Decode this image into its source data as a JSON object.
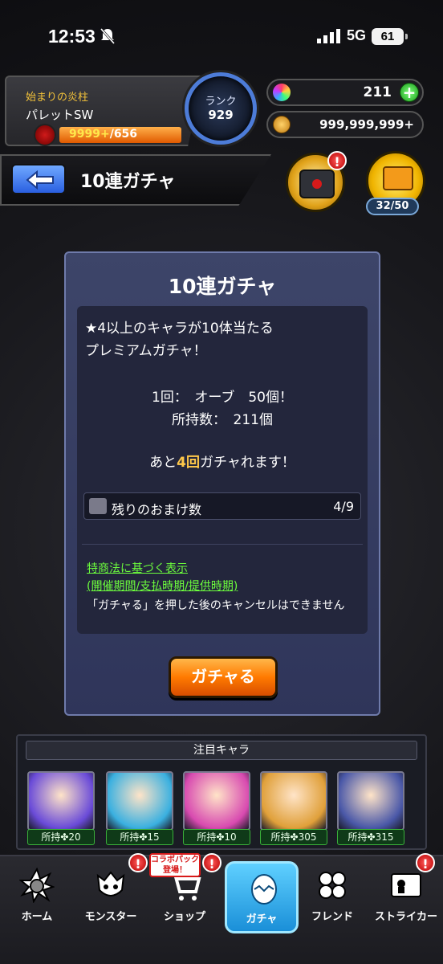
{
  "status_bar": {
    "time": "12:53",
    "network": "5G",
    "battery": "61"
  },
  "player": {
    "title": "始まりの炎柱",
    "name": "パレットSW",
    "stamina_current": "9999+",
    "stamina_max": "/656",
    "rank_label": "ランク",
    "rank": "929"
  },
  "resources": {
    "orbs": "211",
    "gold": "999,999,999+"
  },
  "page": {
    "title": "10連ガチャ",
    "reward_count": "32/50"
  },
  "dialog": {
    "title": "10連ガチャ",
    "desc_line1": "★4以上のキャラが10体当たる",
    "desc_line2": "プレミアムガチャ！",
    "cost_line": "1回：　オーブ　50個！",
    "owned_line": "所持数：　211個",
    "remain_prefix": "あと",
    "remain_count": "4回",
    "remain_suffix": "ガチャれます！",
    "bonus_label": "残りのおまけ数",
    "bonus_value": "4/9",
    "legal_link1": "特商法に基づく表示",
    "legal_link2": "(開催期間/支払時期/提供時期)",
    "legal_note": "「ガチャる」を押した後のキャンセルはできません",
    "gacha_button": "ガチャる"
  },
  "featured": {
    "title": "注目キャラ",
    "cards": [
      {
        "owned": "所持✤20",
        "color": "#6a4bd8"
      },
      {
        "owned": "所持✤15",
        "color": "#3ab0e0"
      },
      {
        "owned": "所持✤10",
        "color": "#d84ab0"
      },
      {
        "owned": "所持✤305",
        "color": "#e0a03a"
      },
      {
        "owned": "所持✤315",
        "color": "#4a58a8"
      }
    ]
  },
  "nav": {
    "items": [
      {
        "label": "ホーム"
      },
      {
        "label": "モンスター"
      },
      {
        "label": "ショップ"
      },
      {
        "label": "ガチャ"
      },
      {
        "label": "フレンド"
      },
      {
        "label": "ストライカー"
      }
    ],
    "collab_badge": "コラボパック登場！"
  },
  "colors": {
    "accent_blue": "#4d7cd8",
    "gacha_orange": "#ff7a00",
    "legal_green": "#6dff3d",
    "highlight": "#ffc84a"
  }
}
